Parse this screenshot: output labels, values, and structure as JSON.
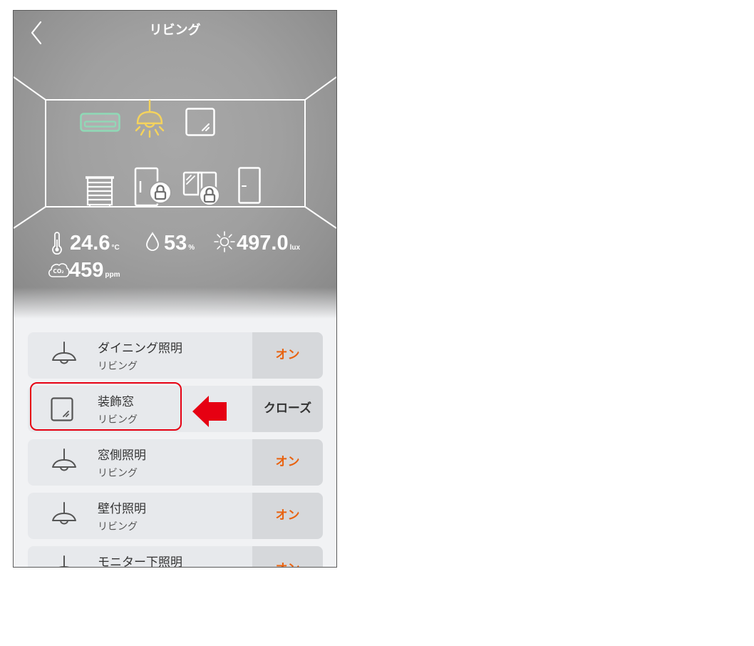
{
  "header": {
    "title": "リビング",
    "back_icon": "chevron-left-icon"
  },
  "room_map": {
    "devices": [
      {
        "icon": "air-conditioner-icon"
      },
      {
        "icon": "ceiling-lamp-icon"
      },
      {
        "icon": "window-icon"
      },
      {
        "icon": "blind-icon"
      },
      {
        "icon": "locked-door-icon"
      },
      {
        "icon": "locked-window-icon"
      },
      {
        "icon": "door-icon"
      }
    ]
  },
  "sensors": {
    "temperature": {
      "icon": "thermometer-icon",
      "value": "24.6",
      "unit": "°C"
    },
    "humidity": {
      "icon": "water-drop-icon",
      "value": "53",
      "unit": "%"
    },
    "illuminance": {
      "icon": "sun-icon",
      "value": "497.0",
      "unit": "lux"
    },
    "co2": {
      "icon": "co2-icon",
      "icon_label": "CO₂",
      "value": "459",
      "unit": "ppm"
    }
  },
  "devices": [
    {
      "icon": "pendant-lamp-icon",
      "name": "ダイニング照明",
      "room": "リビング",
      "action": "オン",
      "action_color": "#e8620f"
    },
    {
      "icon": "window-icon",
      "name": "装飾窓",
      "room": "リビング",
      "action": "クローズ",
      "action_color": "#333333"
    },
    {
      "icon": "pendant-lamp-icon",
      "name": "窓側照明",
      "room": "リビング",
      "action": "オン",
      "action_color": "#e8620f"
    },
    {
      "icon": "pendant-lamp-icon",
      "name": "壁付照明",
      "room": "リビング",
      "action": "オン",
      "action_color": "#e8620f"
    },
    {
      "icon": "pendant-lamp-icon",
      "name": "モニター下照明",
      "action": "オン",
      "action_color": "#e8620f"
    }
  ],
  "colors": {
    "list_background": "#f1f2f4",
    "card": "#e7e9ec",
    "action_button": "#d6d8db",
    "ac_icon": "#8fd9b6",
    "lamp_icon": "#f5d35c",
    "annotation_red": "#e60012"
  }
}
